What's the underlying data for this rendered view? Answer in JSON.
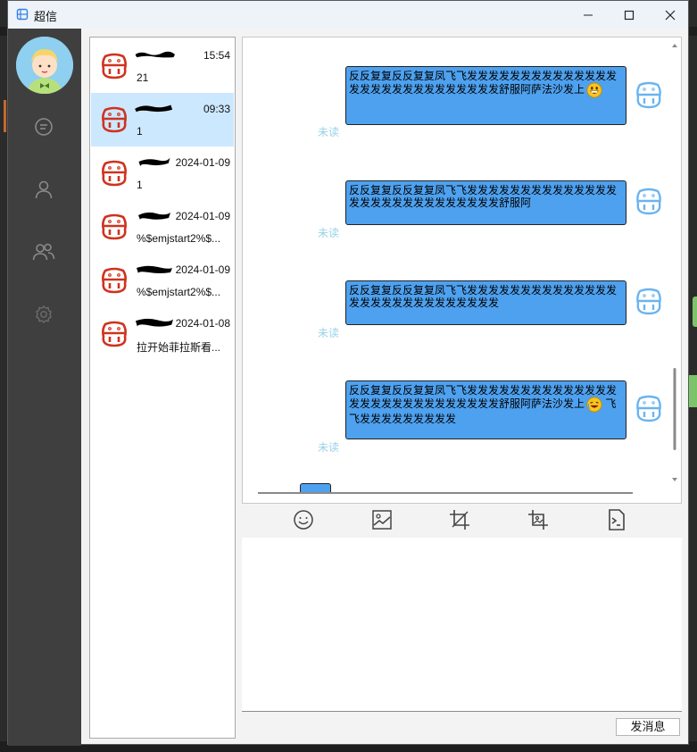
{
  "window": {
    "title": "超信"
  },
  "conversations": [
    {
      "time": "15:54",
      "last": "21"
    },
    {
      "time": "09:33",
      "last": "1"
    },
    {
      "time": "2024-01-09",
      "last": "1"
    },
    {
      "time": "2024-01-09",
      "last": "%$emjstart2%$..."
    },
    {
      "time": "2024-01-09",
      "last": "%$emjstart2%$..."
    },
    {
      "time": "2024-01-08",
      "last": "拉开始菲拉斯看..."
    }
  ],
  "messages": [
    {
      "text": "反反复复反反复复凤飞飞发发发发发发发发发发发发发发发发发发发发发发发发发发发发舒服阿萨法沙发上",
      "emoji": "grin-emoji",
      "tail": "",
      "status": "未读"
    },
    {
      "text": "反反复复反反复复凤飞飞发发发发发发发发发发发发发发发发发发发发发发发发发发发发舒服阿",
      "emoji": "",
      "tail": "",
      "status": "未读"
    },
    {
      "text": "反反复复反反复复凤飞飞发发发发发发发发发发发发发发发发发发发发发发发发发发发发",
      "emoji": "",
      "tail": "",
      "status": "未读"
    },
    {
      "text": "反反复复反反复复凤飞飞发发发发发发发发发发发发发发发发发发发发发发发发发发发发舒服阿萨法沙发上",
      "emoji": "laugh-emoji",
      "tail": " 飞飞发发发发发发发发发",
      "status": "未读"
    }
  ],
  "send": {
    "label": "发消息"
  },
  "colors": {
    "bubble": "#4ea1ef",
    "selected": "#cce8ff",
    "sidebar": "#3f3f3f",
    "unread": "#9ad3e8",
    "avatar_red": "#d0321e"
  }
}
